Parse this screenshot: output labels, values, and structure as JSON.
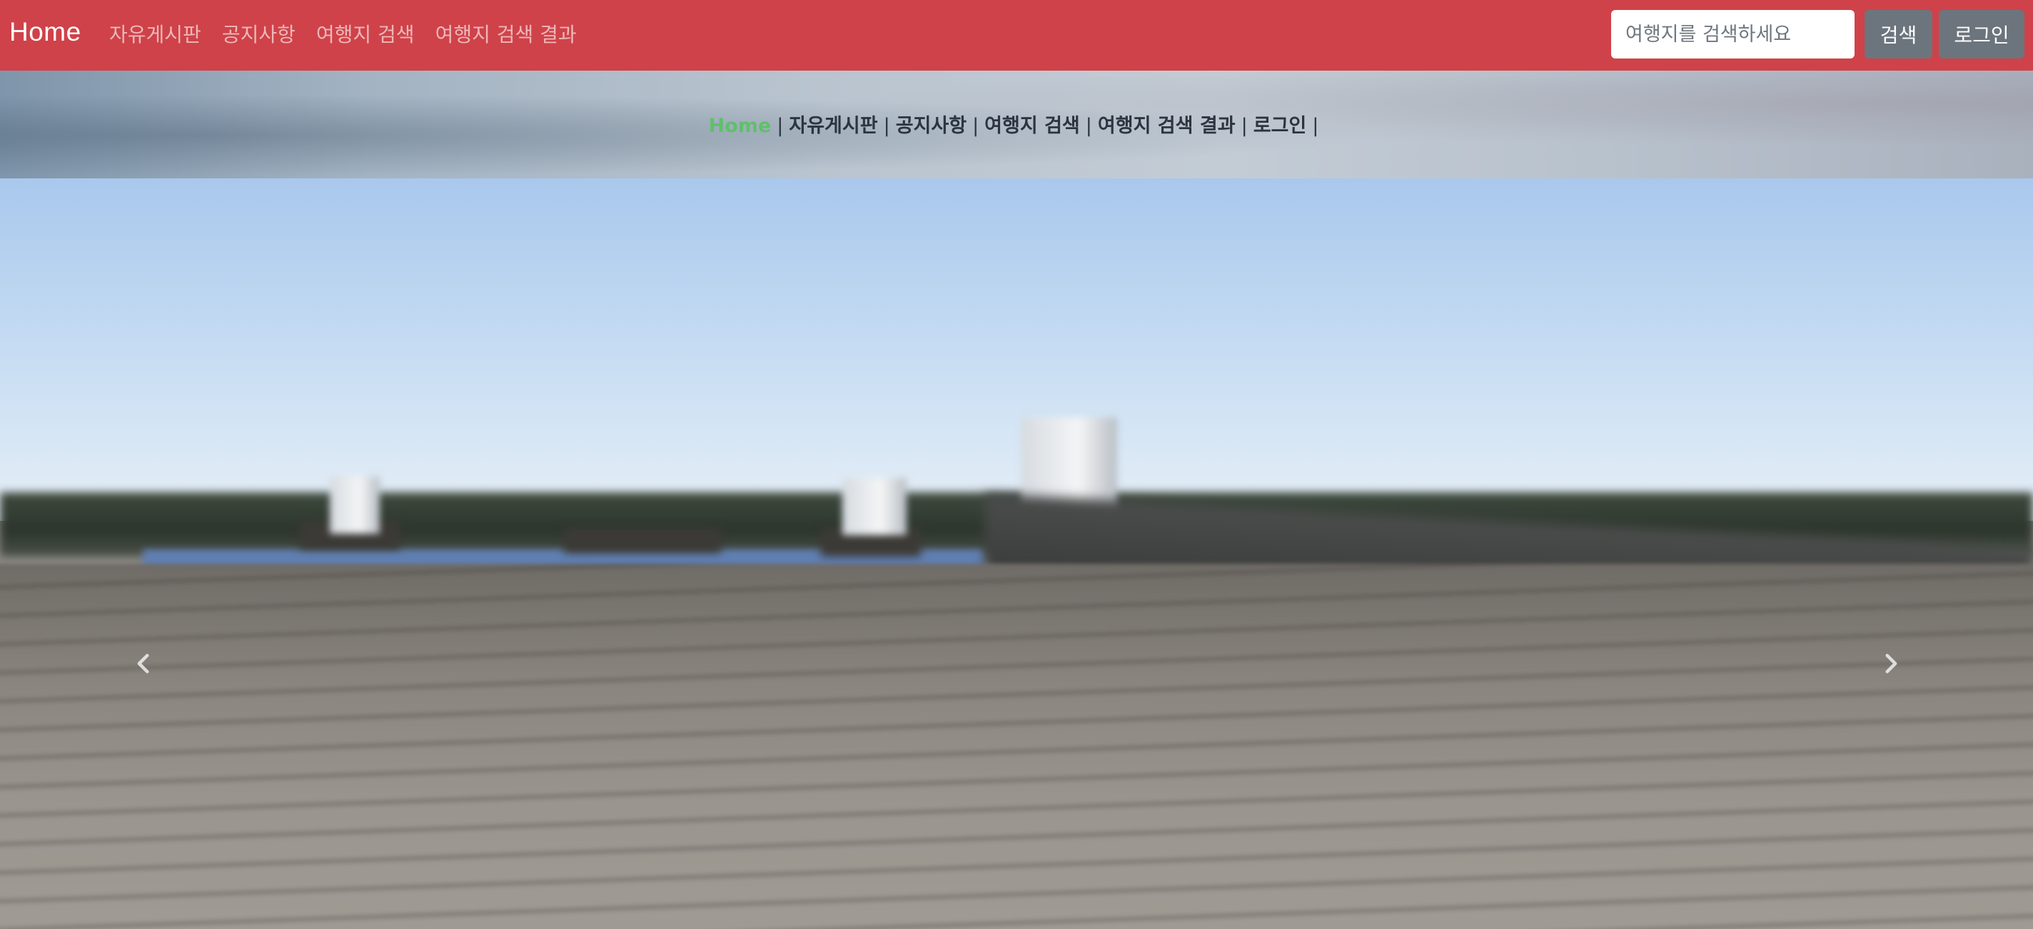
{
  "navbar": {
    "brand": "Home",
    "links": [
      "자유게시판",
      "공지사항",
      "여행지 검색",
      "여행지 검색 결과"
    ],
    "search": {
      "placeholder": "여행지를 검색하세요",
      "value": ""
    },
    "search_button": "검색",
    "login_button": "로그인",
    "background_color": "#cf4249"
  },
  "subnav": {
    "items": [
      "Home",
      "자유게시판",
      "공지사항",
      "여행지 검색",
      "여행지 검색 결과",
      "로그인"
    ],
    "separator": "|",
    "active_color": "#5fc06b"
  },
  "carousel": {
    "prev_icon": "chevron-left-icon",
    "next_icon": "chevron-right-icon"
  }
}
